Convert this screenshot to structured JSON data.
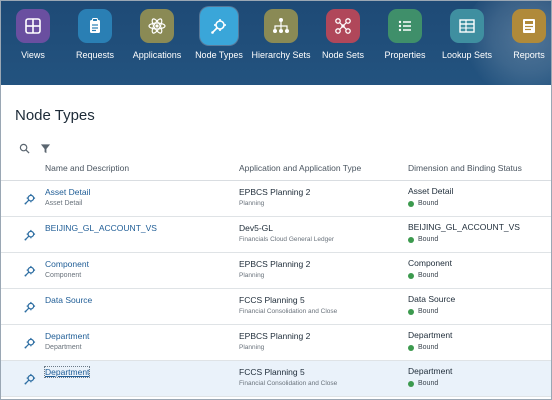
{
  "nav": {
    "items": [
      {
        "label": "Views",
        "icon": "grid-icon",
        "color": "#6a4fa0"
      },
      {
        "label": "Requests",
        "icon": "clipboard-icon",
        "color": "#2a7fb4"
      },
      {
        "label": "Applications",
        "icon": "atom-icon",
        "color": "#8a8a55"
      },
      {
        "label": "Node Types",
        "icon": "node-gear-icon",
        "color": "#3aa6d9"
      },
      {
        "label": "Hierarchy Sets",
        "icon": "hierarchy-icon",
        "color": "#8a8a55"
      },
      {
        "label": "Node Sets",
        "icon": "nodes-icon",
        "color": "#b0475a"
      },
      {
        "label": "Properties",
        "icon": "list-icon",
        "color": "#3f8f6a"
      },
      {
        "label": "Lookup Sets",
        "icon": "table-icon",
        "color": "#3f8fa0"
      },
      {
        "label": "Reports",
        "icon": "report-icon",
        "color": "#b08a3a"
      }
    ],
    "active_index": 3
  },
  "page": {
    "title": "Node Types"
  },
  "table": {
    "headers": {
      "name": "Name and Description",
      "app": "Application and Application Type",
      "dim": "Dimension and Binding Status"
    },
    "status_color": "#3c9a4e",
    "rows": [
      {
        "name": "Asset Detail",
        "desc": "Asset Detail",
        "app": "EPBCS Planning 2",
        "apptype": "Planning",
        "dim": "Asset Detail",
        "status": "Bound"
      },
      {
        "name": "BEIJING_GL_ACCOUNT_VS",
        "desc": "",
        "app": "Dev5-GL",
        "apptype": "Financials Cloud General Ledger",
        "dim": "BEIJING_GL_ACCOUNT_VS",
        "status": "Bound"
      },
      {
        "name": "Component",
        "desc": "Component",
        "app": "EPBCS Planning 2",
        "apptype": "Planning",
        "dim": "Component",
        "status": "Bound"
      },
      {
        "name": "Data Source",
        "desc": "",
        "app": "FCCS Planning 5",
        "apptype": "Financial Consolidation and Close",
        "dim": "Data Source",
        "status": "Bound"
      },
      {
        "name": "Department",
        "desc": "Department",
        "app": "EPBCS Planning 2",
        "apptype": "Planning",
        "dim": "Department",
        "status": "Bound"
      },
      {
        "name": "Department",
        "desc": "",
        "app": "FCCS Planning 5",
        "apptype": "Financial Consolidation and Close",
        "dim": "Department",
        "status": "Bound"
      }
    ],
    "selected_index": 5
  }
}
